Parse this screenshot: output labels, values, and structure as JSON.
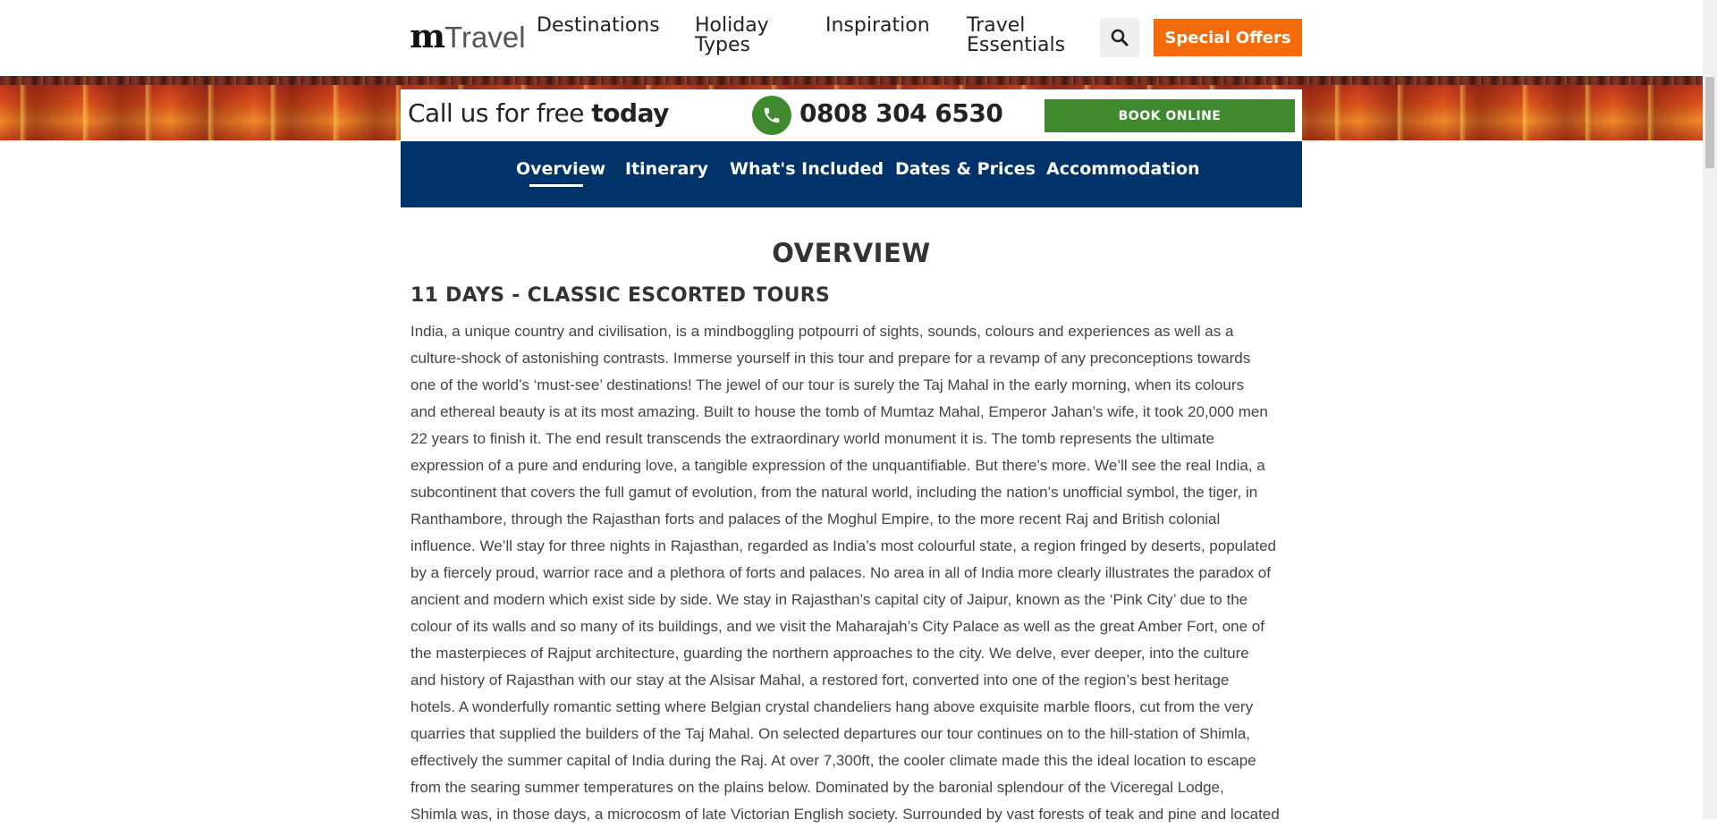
{
  "header": {
    "logo_mark": "m",
    "logo_text": "Travel",
    "nav": [
      {
        "label": "Destinations"
      },
      {
        "label": "Holiday Types"
      },
      {
        "label": "Inspiration"
      },
      {
        "label": "Travel Essentials"
      }
    ],
    "special_offers_label": "Special Offers",
    "search_icon": "search-icon"
  },
  "callbar": {
    "text_prefix": "Call us for free ",
    "text_bold": "today",
    "phone": "0808 304 6530",
    "phone_icon": "phone-icon",
    "book_label": "BOOK ONLINE"
  },
  "tabs": [
    {
      "label": "Overview",
      "active": true
    },
    {
      "label": "Itinerary"
    },
    {
      "label": "What's Included"
    },
    {
      "label": "Dates & Prices"
    },
    {
      "label": "Accommodation"
    }
  ],
  "colors": {
    "accent_orange": "#f46b0b",
    "accent_green": "#3f8a2f",
    "tab_bar_navy": "#00336a"
  },
  "content": {
    "title": "OVERVIEW",
    "subtitle": "11 DAYS - CLASSIC ESCORTED TOURS",
    "lines": [
      "India, a unique country and civilisation, is a mindboggling potpourri of sights, sounds, colours and experiences as well as a",
      "culture-shock of astonishing contrasts. Immerse yourself in this tour and prepare for a revamp of any preconceptions towards",
      "one of the world’s ‘must-see’ destinations! The jewel of our tour is surely the Taj Mahal in the early morning, when its colours",
      "and ethereal beauty is at its most amazing. Built to house the tomb of Mumtaz Mahal, Emperor Jahan’s wife, it took 20,000 men",
      "22 years to finish it. The end result transcends the extraordinary world monument it is. The tomb represents the ultimate",
      "expression of a pure and enduring love, a tangible expression of the unquantifiable. But there’s more. We’ll see the real India, a",
      "subcontinent that covers the full gamut of evolution, from the natural world, including the nation’s unofficial symbol, the tiger, in",
      "Ranthambore, through the Rajasthan forts and palaces of the Moghul Empire, to the more recent Raj and British colonial",
      "influence. We’ll stay for three nights in Rajasthan, regarded as India’s most colourful state, a region fringed by deserts, populated",
      "by a fiercely proud, warrior race and a plethora of forts and palaces. No area in all of India more clearly illustrates the paradox of",
      "ancient and modern which exist side by side. We stay in Rajasthan’s capital city of Jaipur, known as the ‘Pink City’ due to the",
      "colour of its walls and so many of its buildings, and we visit the Maharajah’s City Palace as well as the great Amber Fort, one of",
      "the masterpieces of Rajput architecture, guarding the northern approaches to the city. We delve, ever deeper, into the culture",
      "and history of Rajasthan with our stay at the Alsisar Mahal, a restored fort, converted into one of the region’s best heritage",
      "hotels. A wonderfully romantic setting where Belgian crystal chandeliers hang above exquisite marble floors, cut from the very",
      "quarries that supplied the builders of the Taj Mahal. On selected departures our tour continues on to the hill-station of Shimla,",
      "effectively the summer capital of India during the Raj. At over 7,300ft, the cooler climate made this the ideal location to escape",
      "from the searing summer temperatures on the plains below. Dominated by the baronial splendour of the Viceregal Lodge,",
      "Shimla was, in those days, a microcosm of late Victorian English society. Surrounded by vast forests of teak and pine and located"
    ]
  }
}
